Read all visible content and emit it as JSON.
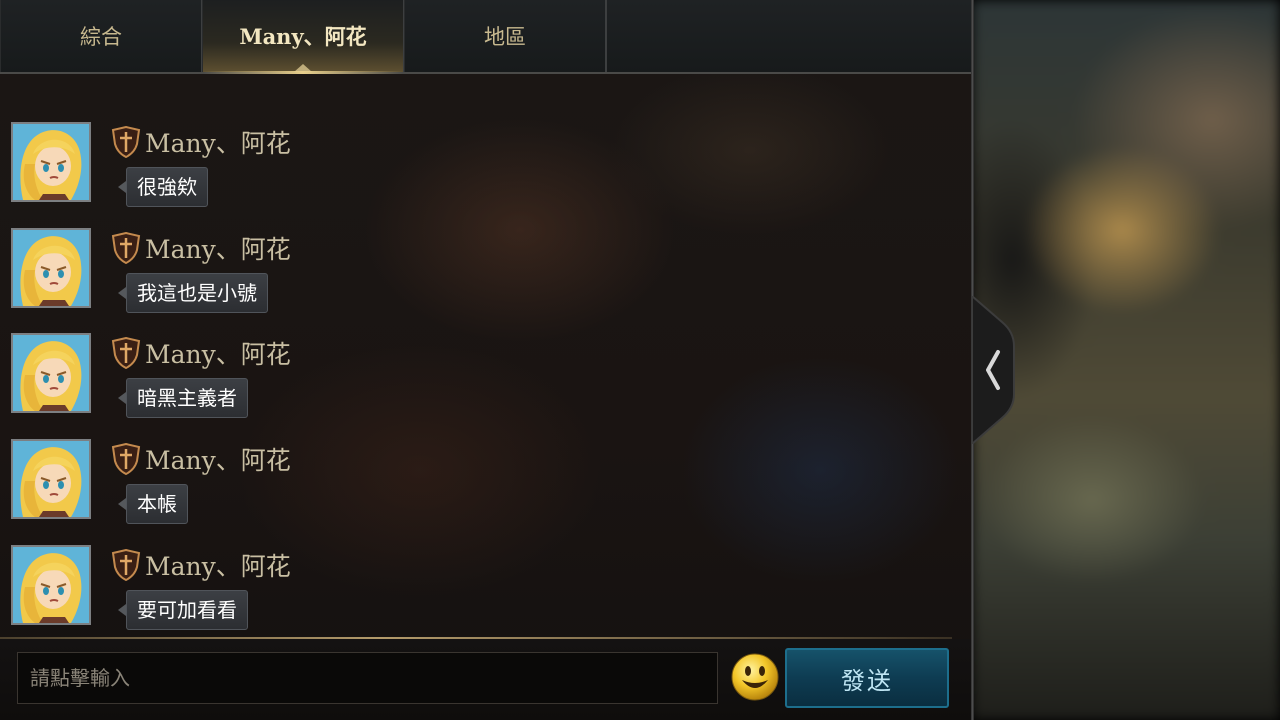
{
  "tabs": [
    {
      "label": "綜合",
      "active": false
    },
    {
      "label": "Many、阿花",
      "active": true
    },
    {
      "label": "地區",
      "active": false
    }
  ],
  "messages": [
    {
      "sender": "Many、阿花",
      "text": "很強欸"
    },
    {
      "sender": "Many、阿花",
      "text": "我這也是小號"
    },
    {
      "sender": "Many、阿花",
      "text": "暗黑主義者"
    },
    {
      "sender": "Many、阿花",
      "text": "本帳"
    },
    {
      "sender": "Many、阿花",
      "text": "要可加看看"
    }
  ],
  "input": {
    "placeholder": "請點擊輸入",
    "value": ""
  },
  "send_label": "發送",
  "icons": {
    "guild": "shield-icon",
    "emoji": "smiley-icon",
    "collapse": "chevron-left-icon"
  },
  "colors": {
    "send_button": "#0e3c52",
    "sender_name": "#c9bfa3",
    "active_tab": "#f3e7c1"
  }
}
